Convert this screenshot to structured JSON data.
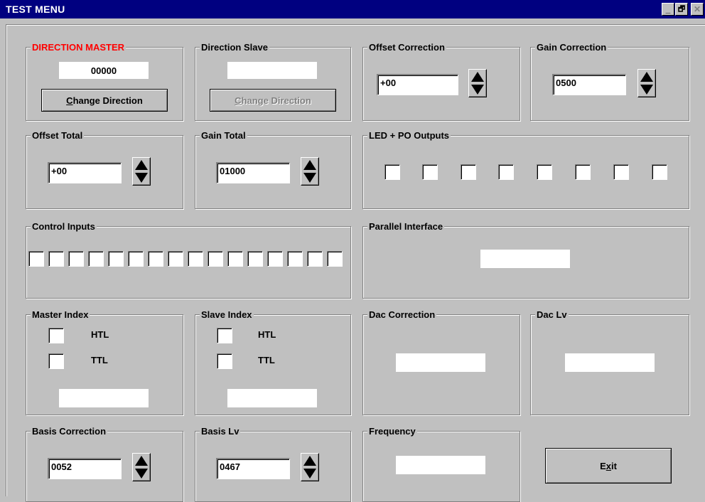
{
  "window": {
    "title": "TEST MENU",
    "controls": {
      "minimize": "_",
      "restore": "🗗",
      "close": "✕"
    }
  },
  "direction_master": {
    "label": "DIRECTION MASTER",
    "value": "00000",
    "button_prefix": "C",
    "button_rest": "hange Direction"
  },
  "direction_slave": {
    "label": "Direction Slave",
    "value": "",
    "button_prefix": "C",
    "button_rest": "hange Direction"
  },
  "offset_correction": {
    "label": "Offset Correction",
    "value": "+00"
  },
  "gain_correction": {
    "label": "Gain Correction",
    "value": "0500"
  },
  "offset_total": {
    "label": "Offset Total",
    "value": "+00"
  },
  "gain_total": {
    "label": "Gain Total",
    "value": "01000"
  },
  "led_po_outputs": {
    "label": "LED + PO Outputs",
    "count": 8
  },
  "control_inputs": {
    "label": "Control Inputs",
    "count": 16
  },
  "parallel_interface": {
    "label": "Parallel Interface",
    "value": ""
  },
  "master_index": {
    "label": "Master Index",
    "options": [
      "HTL",
      "TTL"
    ],
    "value": ""
  },
  "slave_index": {
    "label": "Slave Index",
    "options": [
      "HTL",
      "TTL"
    ],
    "value": ""
  },
  "dac_correction": {
    "label": "Dac Correction",
    "value": ""
  },
  "dac_lv": {
    "label": "Dac Lv",
    "value": ""
  },
  "basis_correction": {
    "label": "Basis Correction",
    "value": "0052"
  },
  "basis_lv": {
    "label": "Basis Lv",
    "value": "0467"
  },
  "frequency": {
    "label": "Frequency",
    "value": ""
  },
  "exit_button": {
    "prefix": "E",
    "underlined": "x",
    "rest": "it"
  },
  "icons": {
    "spin": "up-down-arrows-icon"
  },
  "colors": {
    "titlebar": "#000080",
    "face": "#c0c0c0",
    "accent_red": "#ff0000"
  }
}
